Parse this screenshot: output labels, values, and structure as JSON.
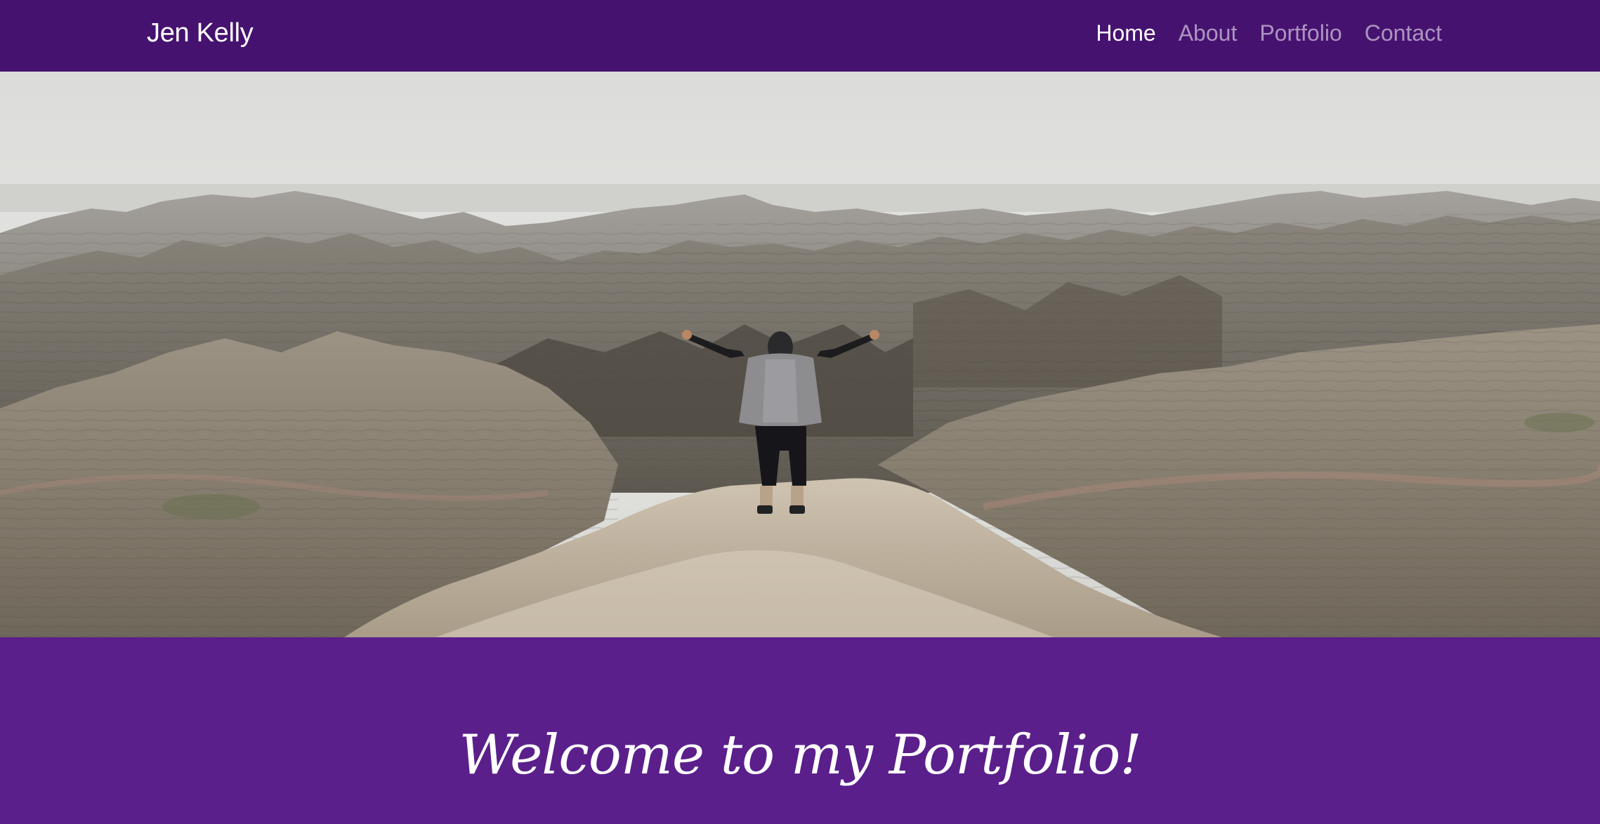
{
  "navbar": {
    "brand": "Jen Kelly",
    "links": [
      {
        "label": "Home",
        "active": true
      },
      {
        "label": "About",
        "active": false
      },
      {
        "label": "Portfolio",
        "active": false
      },
      {
        "label": "Contact",
        "active": false
      }
    ]
  },
  "hero": {
    "image_subject": "person with arms outstretched on a ridge overlooking badlands canyons"
  },
  "welcome": {
    "heading": "Welcome to my Portfolio!"
  },
  "colors": {
    "navbar_bg": "#461270",
    "section_bg": "#5b1f8c",
    "link_active": "#ffffff",
    "link_inactive": "#b39bc9"
  }
}
